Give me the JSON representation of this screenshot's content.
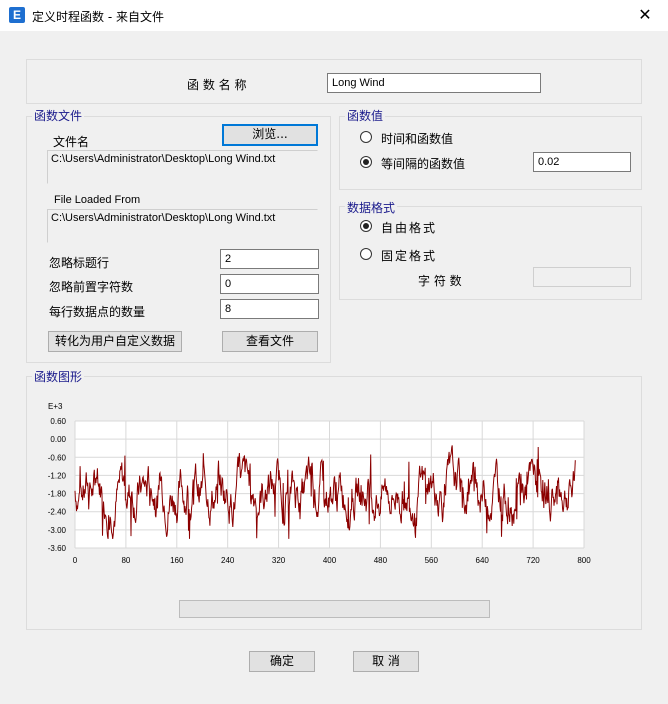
{
  "window": {
    "title": "定义时程函数 - 来自文件",
    "icon_letter": "E",
    "close_glyph": "✕"
  },
  "function_name": {
    "label": "函 数 名 称",
    "value": "Long Wind"
  },
  "file_group": {
    "legend": "函数文件",
    "file_name_label": "文件名",
    "browse_label": "浏览...",
    "file_path": "C:\\Users\\Administrator\\Desktop\\Long Wind.txt",
    "loaded_from_label": "File Loaded From",
    "loaded_path": "C:\\Users\\Administrator\\Desktop\\Long Wind.txt",
    "skip_header_label": "忽略标题行",
    "skip_header_value": "2",
    "skip_chars_label": "忽略前置字符数",
    "skip_chars_value": "0",
    "points_per_line_label": "每行数据点的数量",
    "points_per_line_value": "8",
    "convert_label": "转化为用户自定义数据",
    "view_file_label": "查看文件"
  },
  "values_group": {
    "legend": "函数值",
    "option_time_value": "时间和函数值",
    "option_equal_interval": "等间隔的函数值",
    "interval_value": "0.02",
    "selected": "equal_interval"
  },
  "format_group": {
    "legend": "数据格式",
    "option_free": "自由格式",
    "option_fixed": "固定格式",
    "char_count_label": "字 符 数",
    "selected": "free"
  },
  "graph_group": {
    "legend": "函数图形"
  },
  "chart_data": {
    "type": "line",
    "exponent_label": "E+3",
    "xlim": [
      0,
      800
    ],
    "ylim": [
      -3.6,
      0.6
    ],
    "xticks": [
      "0",
      "80",
      "160",
      "240",
      "320",
      "400",
      "480",
      "560",
      "640",
      "720",
      "800"
    ],
    "yticks": [
      "0.60",
      "0.00",
      "-0.60",
      "-1.20",
      "-1.80",
      "-2.40",
      "-3.00",
      "-3.60"
    ],
    "grid": true,
    "series_color": "#8b0000",
    "x_start": 0,
    "x_end": 787,
    "y_mean": -1.7,
    "y_min": -3.3,
    "y_max": -0.1
  },
  "buttons": {
    "ok": "确定",
    "cancel": "取 消"
  },
  "colors": {
    "accent": "#0078d7",
    "legend_text": "#1a1a8c"
  }
}
